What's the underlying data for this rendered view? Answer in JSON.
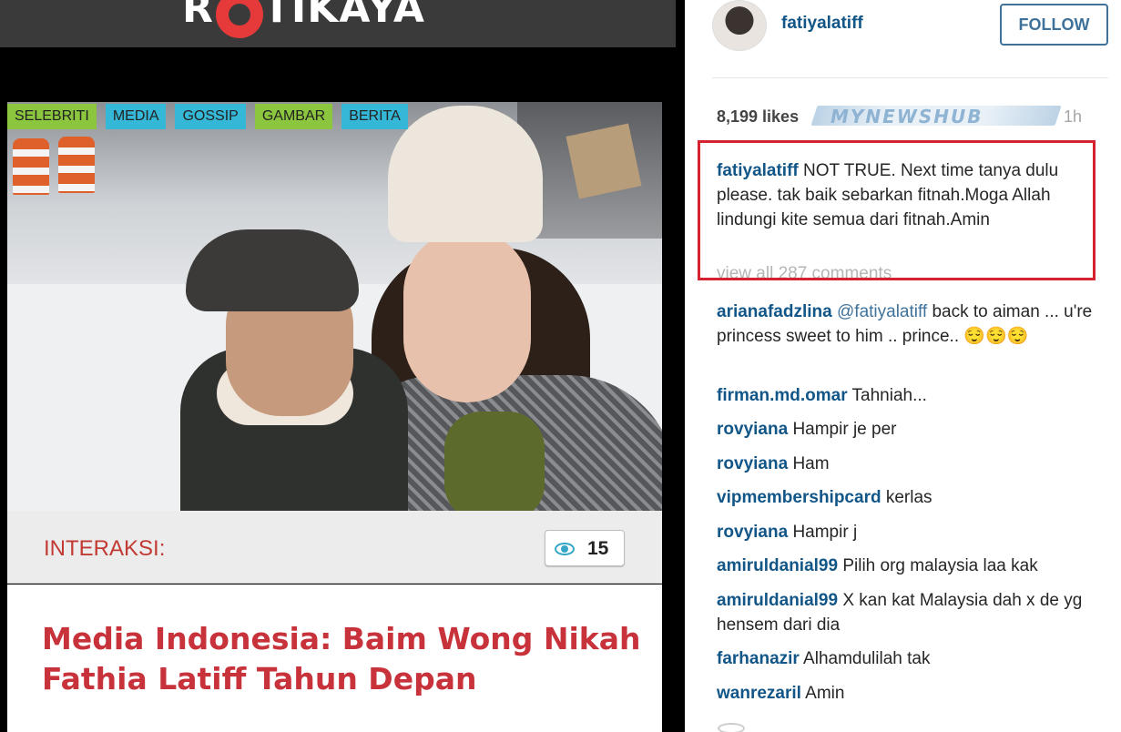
{
  "site": {
    "logo_text": "ROTIKAYA",
    "tags": [
      "SELEBRITI",
      "MEDIA",
      "GOSSIP",
      "GAMBAR",
      "BERITA"
    ],
    "interaksi_label": "INTERAKSI:",
    "views_count": "15",
    "article_title": "Media Indonesia: Baim Wong Nikah Fathia Latiff Tahun Depan"
  },
  "post": {
    "username": "fatiyalatiff",
    "follow_label": "FOLLOW",
    "likes": "8,199 likes",
    "time": "1h",
    "watermark": "MYNEWSHUB",
    "caption": {
      "user": "fatiyalatiff",
      "text": "NOT TRUE. Next time tanya dulu please. tak baik sebarkan fitnah.Moga Allah lindungi kite semua dari fitnah.Amin"
    },
    "view_all": "view all 287 comments",
    "comments": [
      {
        "user": "arianafadzlina",
        "mention": "@fatiyalatiff",
        "text": "back to aiman ... u're princess sweet to him .. prince.. 😌😌😌"
      },
      {
        "user": "firman.md.omar",
        "mention": "",
        "text": "Tahniah..."
      },
      {
        "user": "rovyiana",
        "mention": "",
        "text": "Hampir je per"
      },
      {
        "user": "rovyiana",
        "mention": "",
        "text": "Ham"
      },
      {
        "user": "vipmembershipcard",
        "mention": "",
        "text": "kerlas"
      },
      {
        "user": "rovyiana",
        "mention": "",
        "text": "Hampir j"
      },
      {
        "user": "amiruldanial99",
        "mention": "",
        "text": "Pilih org malaysia laa kak"
      },
      {
        "user": "amiruldanial99",
        "mention": "",
        "text": "X kan kat Malaysia dah x de yg hensem dari dia"
      },
      {
        "user": "farhanazir",
        "mention": "",
        "text": "Alhamdulilah tak"
      },
      {
        "user": "wanrezaril",
        "mention": "",
        "text": "Amin"
      }
    ]
  },
  "colors": {
    "instagram_blue": "#125688",
    "highlight_red": "#d4232e",
    "headline_red": "#c8323a",
    "tag_green": "#8cc63f",
    "tag_cyan": "#35b8d7"
  }
}
